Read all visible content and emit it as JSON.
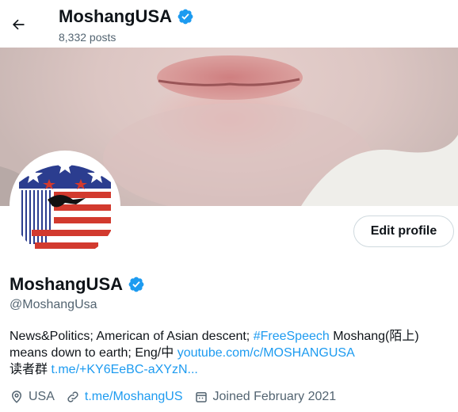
{
  "header": {
    "title": "MoshangUSA",
    "posts_count": "8,332 posts"
  },
  "actions": {
    "edit_profile": "Edit profile"
  },
  "profile": {
    "display_name": "MoshangUSA",
    "handle": "@MoshangUsa",
    "bio": {
      "part1": "News&Politics; American of Asian descent; ",
      "hashtag": "#FreeSpeech",
      "part2": " Moshang(陌上) means down to earth; Eng/中 ",
      "link1": "youtube.com/c/MOSHANGUSA",
      "part3": "读者群 ",
      "link2": "t.me/+KY6EeBC-aXYzN..."
    },
    "location": "USA",
    "website": "t.me/MoshangUS",
    "joined": "Joined February 2021"
  },
  "colors": {
    "accent": "#1d9bf0",
    "text": "#0f1419",
    "secondary": "#536471"
  },
  "icons": [
    "arrow-left-icon",
    "verified-badge-icon",
    "location-pin-icon",
    "link-icon",
    "calendar-icon"
  ]
}
